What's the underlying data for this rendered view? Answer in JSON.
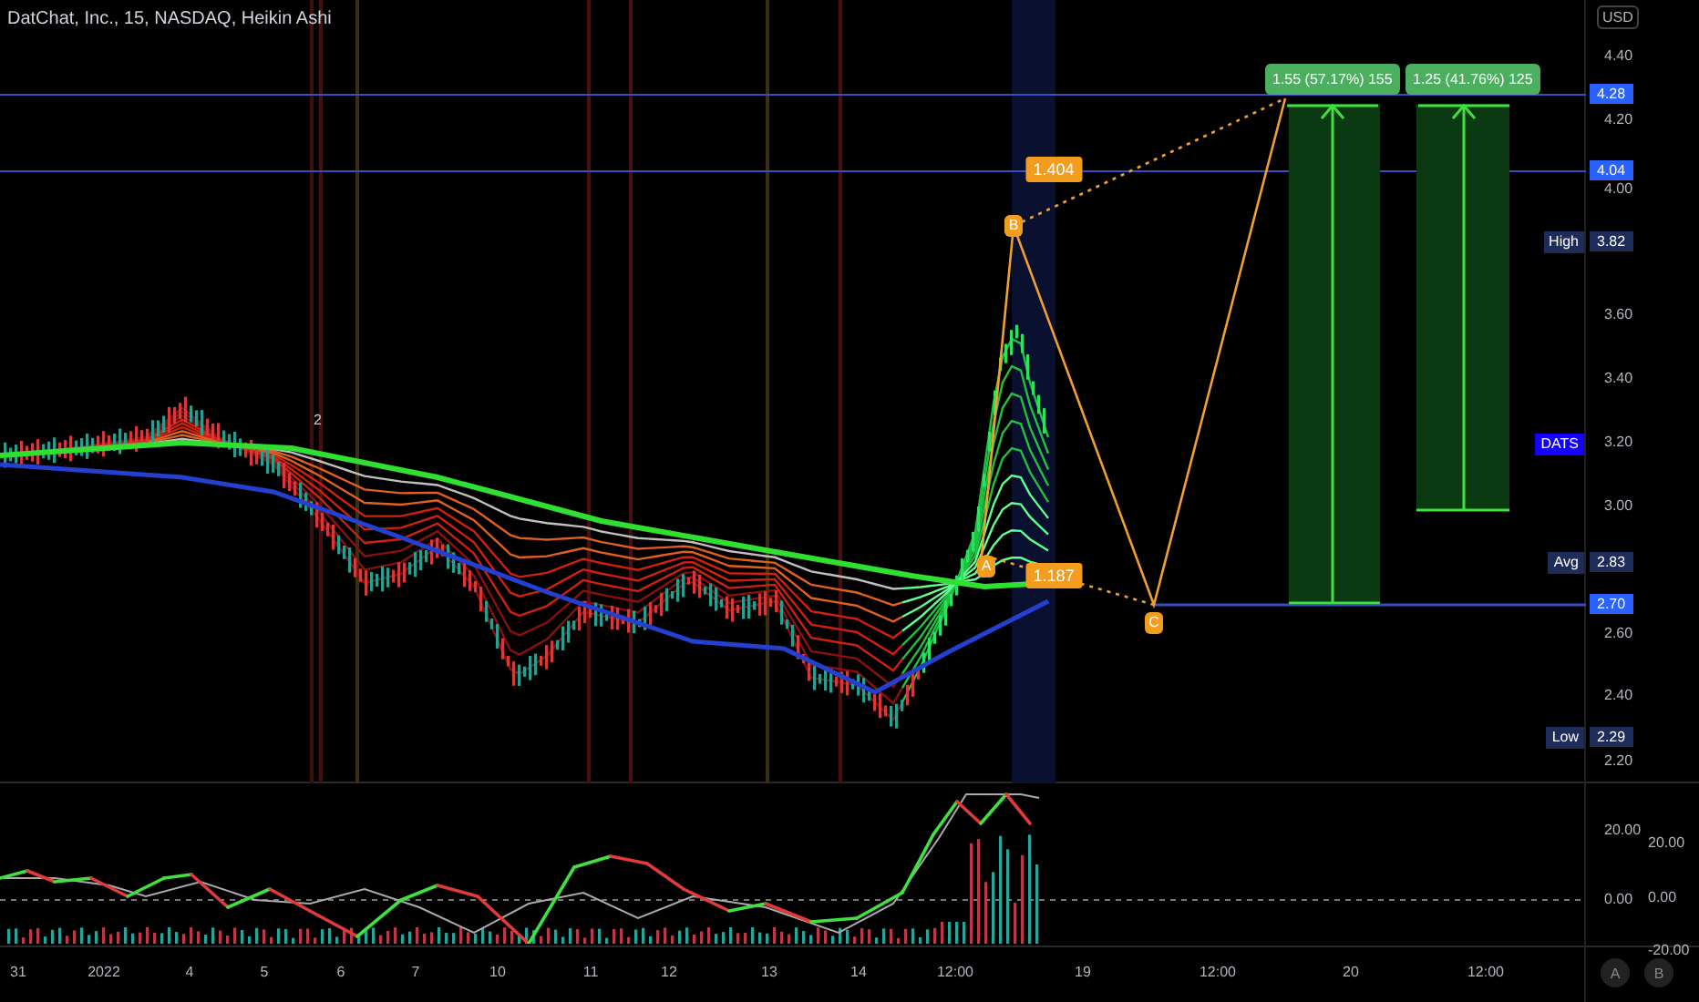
{
  "chart": {
    "title": "DatChat, Inc., 15, NASDAQ, Heikin Ashi",
    "currency": "USD",
    "price_ticks": [
      "4.40",
      "4.20",
      "4.00",
      "3.60",
      "3.40",
      "3.20",
      "3.00",
      "2.60",
      "2.40",
      "2.20"
    ],
    "price_badges": [
      {
        "kind": "line",
        "value": "4.28"
      },
      {
        "kind": "line",
        "value": "4.04"
      },
      {
        "kind": "stat",
        "label": "High",
        "value": "3.82"
      },
      {
        "kind": "symbol",
        "label": "DATS"
      },
      {
        "kind": "stat",
        "label": "Avg",
        "value": "2.83"
      },
      {
        "kind": "line",
        "value": "2.70"
      },
      {
        "kind": "stat",
        "label": "Low",
        "value": "2.29"
      }
    ],
    "pattern_labels": [
      {
        "kind": "point",
        "text": "B"
      },
      {
        "kind": "ratio",
        "text": "1.404"
      },
      {
        "kind": "point",
        "text": "A"
      },
      {
        "kind": "ratio",
        "text": "1.187"
      },
      {
        "kind": "point",
        "text": "C"
      }
    ],
    "targets": [
      "1.55 (57.17%) 155",
      "1.25 (41.76%) 125"
    ],
    "marker": "2"
  },
  "oscillator": {
    "ticks_a": [
      "20.00",
      "0.00"
    ],
    "ticks_b": [
      "20.00",
      "0.00",
      "-20.00"
    ]
  },
  "time_axis": [
    "31",
    "2022",
    "4",
    "5",
    "6",
    "7",
    "10",
    "11",
    "12",
    "13",
    "14",
    "12:00",
    "19",
    "12:00",
    "20",
    "12:00"
  ],
  "scale_buttons": [
    "A",
    "B"
  ]
}
